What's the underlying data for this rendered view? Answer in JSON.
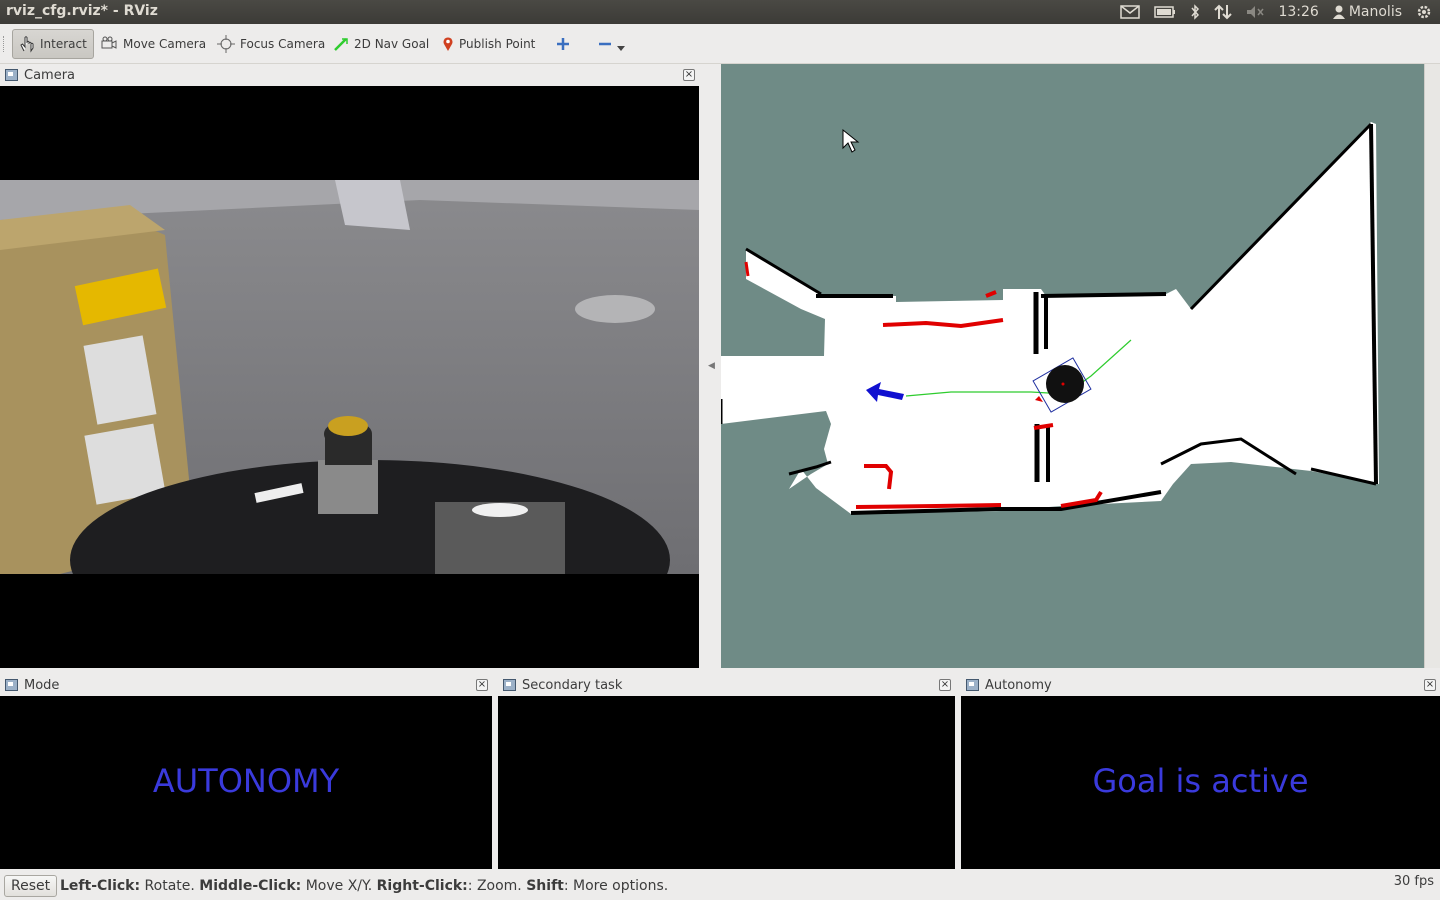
{
  "window": {
    "title": "rviz_cfg.rviz* - RViz"
  },
  "tray": {
    "time": "13:26",
    "user": "Manolis"
  },
  "toolbar": {
    "tools": [
      {
        "label": "Interact",
        "icon": "hand-icon"
      },
      {
        "label": "Move Camera",
        "icon": "move-camera-icon"
      },
      {
        "label": "Focus Camera",
        "icon": "focus-camera-icon"
      },
      {
        "label": "2D Nav Goal",
        "icon": "nav-goal-arrow-icon"
      },
      {
        "label": "Publish Point",
        "icon": "map-pin-icon"
      }
    ],
    "add_icon": "plus-icon",
    "remove_icon": "minus-icon",
    "dropdown_icon": "chevron-down-icon"
  },
  "panels": {
    "camera": {
      "title": "Camera"
    },
    "mode": {
      "title": "Mode",
      "text": "AUTONOMY"
    },
    "secondary": {
      "title": "Secondary task",
      "text": ""
    },
    "autonomy": {
      "title": "Autonomy",
      "text": "Goal is active"
    }
  },
  "status": {
    "reset_label": "Reset",
    "hint_left_click": "Left-Click:",
    "hint_left_action": " Rotate. ",
    "hint_middle_click": "Middle-Click:",
    "hint_middle_action": " Move X/Y. ",
    "hint_right_click": "Right-Click:",
    "hint_right_action": ": Zoom. ",
    "hint_shift": "Shift",
    "hint_shift_action": ": More options.",
    "fps": "30 fps"
  },
  "colors": {
    "map_background": "#6f8b86",
    "overlay_text": "#3a3adc",
    "obstacle_red": "#e00000",
    "path_green": "#2ecc2e",
    "goal_arrow": "#1010d0"
  }
}
